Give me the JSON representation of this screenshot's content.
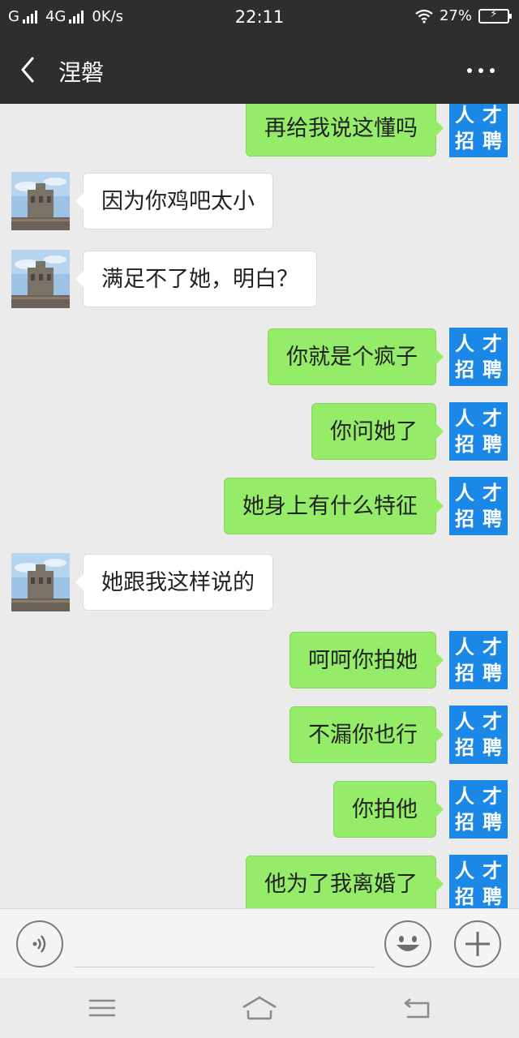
{
  "status_bar": {
    "carrier1": "G",
    "carrier2": "4G",
    "speed": "0K/s",
    "time": "22:11",
    "battery": "27%"
  },
  "header": {
    "title": "涅磐"
  },
  "hire_badge": {
    "chars": [
      "人",
      "才",
      "招",
      "聘"
    ]
  },
  "messages": [
    {
      "side": "out",
      "text": "再给我说这懂吗"
    },
    {
      "side": "in",
      "text": "因为你鸡吧太小"
    },
    {
      "side": "in",
      "text": "满足不了她，明白？"
    },
    {
      "side": "out",
      "text": "你就是个疯子"
    },
    {
      "side": "out",
      "text": "你问她了"
    },
    {
      "side": "out",
      "text": "她身上有什么特征"
    },
    {
      "side": "in",
      "text": "她跟我这样说的"
    },
    {
      "side": "out",
      "text": "呵呵你拍她"
    },
    {
      "side": "out",
      "text": "不漏你也行"
    },
    {
      "side": "out",
      "text": "你拍他"
    },
    {
      "side": "out",
      "text": "他为了我离婚了"
    }
  ],
  "input": {
    "value": "",
    "placeholder": ""
  },
  "icons": {
    "back": "back-arrow-icon",
    "more": "more-dots-icon",
    "voice": "voice-icon",
    "emoji": "emoji-icon",
    "plus": "plus-icon"
  }
}
